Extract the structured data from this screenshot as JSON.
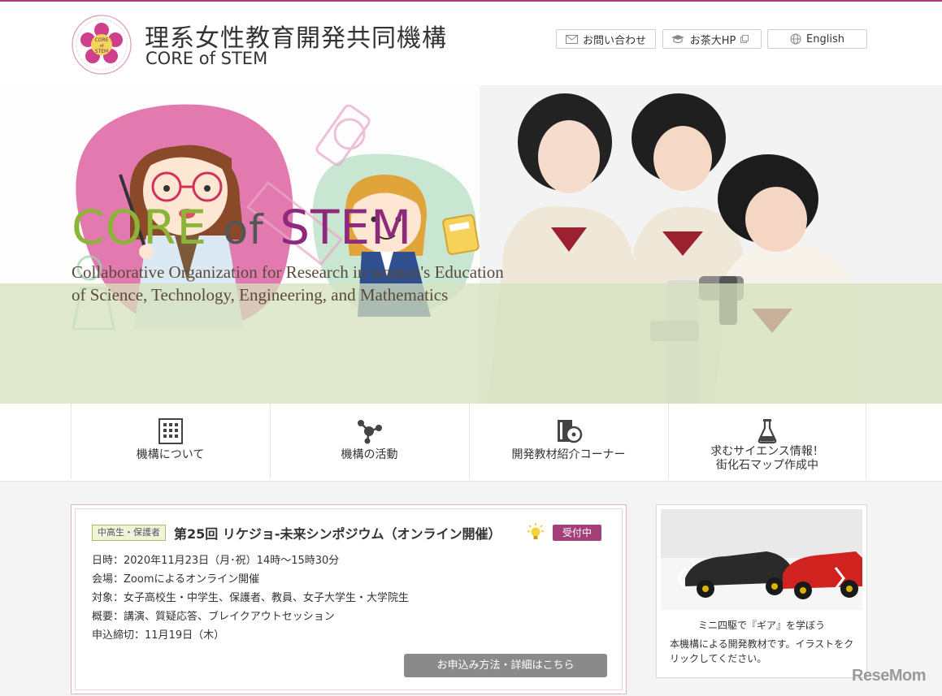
{
  "header": {
    "title": "理系女性教育開発共同機構",
    "subtitle": "CORE of STEM",
    "logo_text": "CORE of STEM",
    "buttons": [
      {
        "label": "お問い合わせ",
        "icon": "mail-icon"
      },
      {
        "label": "お茶大HP",
        "icon": "graduation-cap-icon"
      },
      {
        "label": "English",
        "icon": "globe-icon"
      }
    ]
  },
  "hero": {
    "brand_core": "CORE",
    "brand_of": "of",
    "brand_stem": "STEM",
    "tagline_line1": "Collaborative Organization for Research in women's Education",
    "tagline_line2": "of Science, Technology, Engineering, and Mathematics"
  },
  "nav": {
    "items": [
      {
        "label": "機構について",
        "icon": "building-icon"
      },
      {
        "label": "機構の活動",
        "icon": "molecule-icon"
      },
      {
        "label": "開発教材紹介コーナー",
        "icon": "book-disc-icon"
      },
      {
        "label_line1": "求むサイエンス情報！",
        "label_line2": "街化石マップ作成中",
        "icon": "flask-icon"
      }
    ]
  },
  "event": {
    "audience_tag": "中高生・保護者",
    "title": "第25回 リケジョ-未来シンポジウム（オンライン開催）",
    "status_badge": "受付中",
    "lines": [
      "日時：2020年11月23日（月･祝）14時～15時30分",
      "会場：Zoomによるオンライン開催",
      "対象：女子高校生・中学生、保護者、教員、女子大学生・大学院生",
      "概要：講演、質疑応答、ブレイクアウトセッション",
      "申込締切：11月19日（木）"
    ],
    "apply_button": "お申込み方法・詳細はこちら"
  },
  "side": {
    "caption": "ミニ四駆で『ギア』を学ぼう",
    "description": "本機構による開発教材です。イラストをクリックしてください。"
  },
  "watermark": "ReseMom",
  "colors": {
    "accent_purple": "#a3407a",
    "brand_green": "#8cb438",
    "brand_purple": "#8e2a7c",
    "button_gray": "#8a8a8a"
  }
}
